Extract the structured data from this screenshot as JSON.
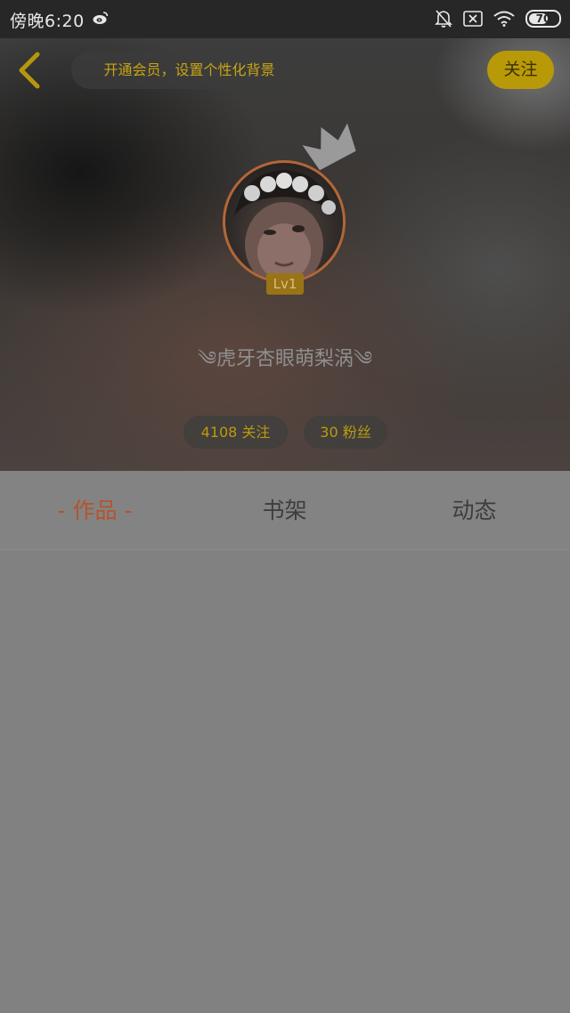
{
  "status_bar": {
    "time": "傍晚6:20",
    "battery": "70",
    "battery_level": 0.7,
    "icons": [
      "weibo-icon",
      "mute-bell-icon",
      "no-sim-icon",
      "wifi-icon",
      "battery-icon"
    ]
  },
  "header": {
    "back_icon": "chevron-left-icon",
    "vip_banner": "开通会员，设置个性化背景",
    "follow_label": "关注"
  },
  "profile": {
    "level": "Lv1",
    "username": "༄虎牙杏眼萌梨涡༄",
    "following": "4108 关注",
    "fans": "30 粉丝",
    "crown_icon": "crown-icon"
  },
  "tabs": [
    {
      "label": "- 作品 -",
      "active": true
    },
    {
      "label": "书架",
      "active": false
    },
    {
      "label": "动态",
      "active": false
    }
  ],
  "colors": {
    "accent_gold": "#b89a08",
    "active_tab": "#b4542d",
    "avatar_ring": "#b36638"
  }
}
